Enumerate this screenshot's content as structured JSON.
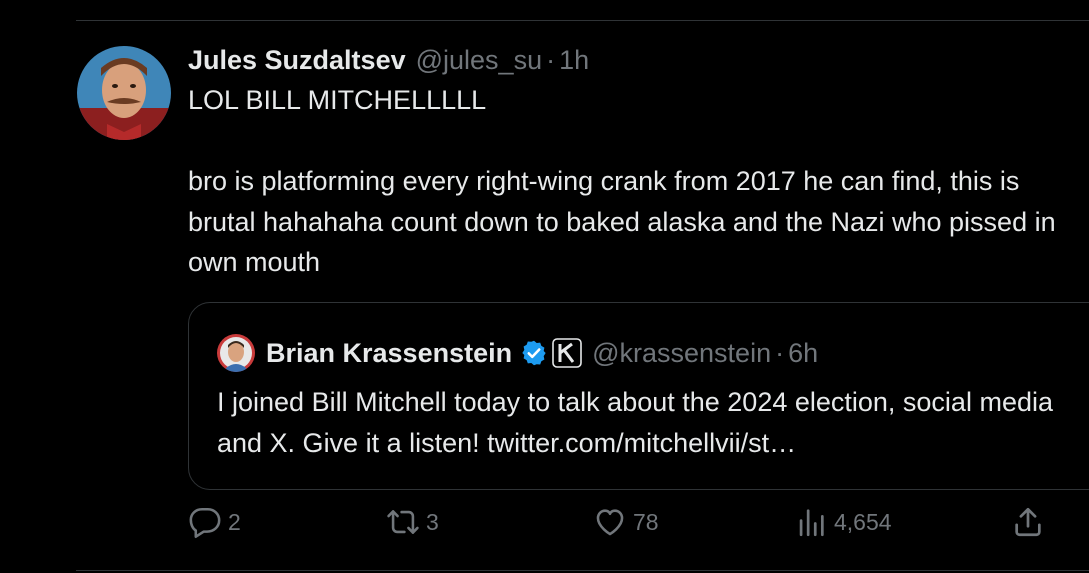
{
  "tweet": {
    "author_name": "Jules Suzdaltsev",
    "handle": "@jules_su",
    "separator": "·",
    "time": "1h",
    "text": "LOL BILL MITCHELLLLL\n\nbro is platforming every right-wing crank from 2017 he can find, this is brutal hahahaha count down to baked alaska and the Nazi who pissed in own mouth"
  },
  "quote": {
    "author_name": "Brian Krassenstein",
    "handle": "@krassenstein",
    "separator": "·",
    "time": "6h",
    "text": "I joined Bill Mitchell today to talk about the 2024 election, social media and X.  Give it a listen! twitter.com/mitchellvii/st…"
  },
  "actions": {
    "replies": "2",
    "reposts": "3",
    "likes": "78",
    "views": "4,654"
  },
  "icons": {
    "reply": "reply-icon",
    "repost": "repost-icon",
    "like": "heart-icon",
    "views": "views-icon",
    "share": "share-icon",
    "verified": "verified-badge-icon",
    "affiliate": "affiliate-badge-icon"
  },
  "colors": {
    "background": "#000000",
    "text": "#e7e9ea",
    "muted": "#71767b",
    "border": "#2f3336",
    "verified": "#1d9bf0"
  }
}
